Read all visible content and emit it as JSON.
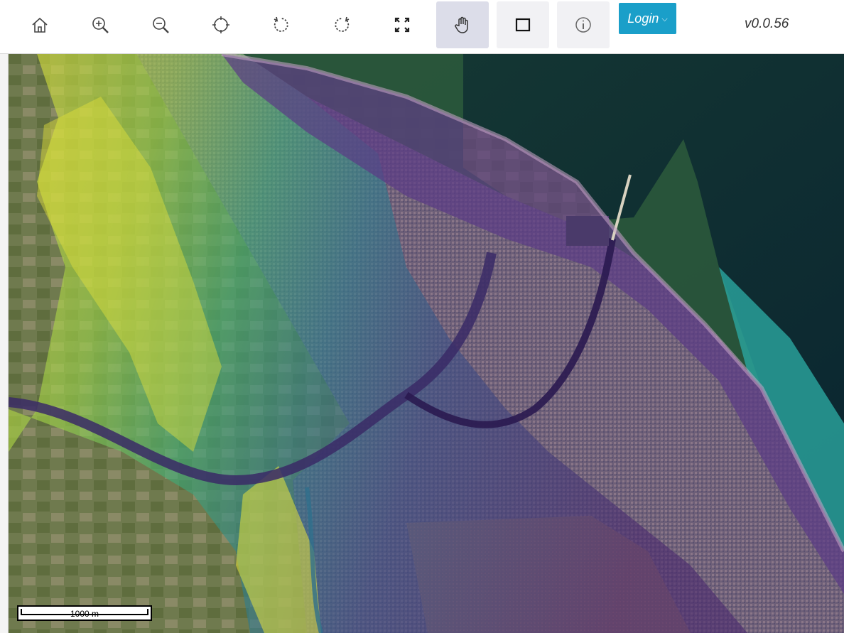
{
  "toolbar": {
    "tools": [
      {
        "id": "home",
        "icon": "home-icon"
      },
      {
        "id": "zoom-in",
        "icon": "zoom-in-icon"
      },
      {
        "id": "zoom-out",
        "icon": "zoom-out-icon"
      },
      {
        "id": "reset-rotation",
        "icon": "compass-rotate-icon"
      },
      {
        "id": "rotate-left",
        "icon": "rotate-ccw-icon"
      },
      {
        "id": "rotate-right",
        "icon": "rotate-cw-icon"
      },
      {
        "id": "fullscreen",
        "icon": "fullscreen-icon"
      },
      {
        "id": "pan",
        "icon": "hand-icon",
        "active": true
      },
      {
        "id": "box-select",
        "icon": "rectangle-select-icon"
      },
      {
        "id": "info",
        "icon": "info-icon"
      }
    ],
    "login_label": "Login",
    "version": "v0.0.56"
  },
  "map": {
    "scale_label": "1000 m",
    "colors": {
      "sea_dark": "#0d2b38",
      "sea_green": "#2d5a3c",
      "shallow_teal": "#2aa6a0",
      "flood_purple": "#4b2a6e",
      "flood_blue": "#3b5b8c",
      "flood_teal": "#2f9a8d",
      "flood_green": "#5fc25a",
      "flood_yellow": "#e5e23a",
      "land": "#8a7f6a"
    }
  }
}
